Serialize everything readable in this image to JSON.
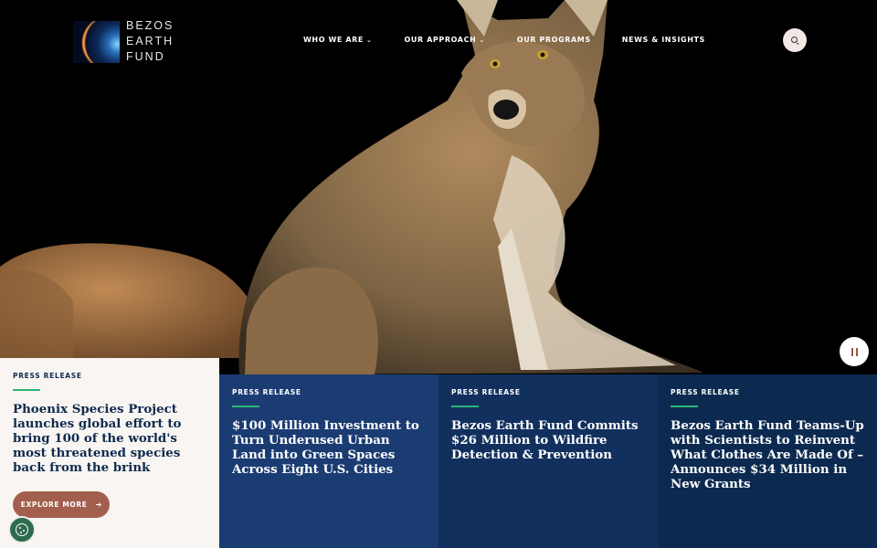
{
  "brand": {
    "name_lines": [
      "BEZOS",
      "EARTH",
      "FUND"
    ]
  },
  "nav": {
    "items": [
      {
        "label": "WHO WE ARE",
        "has_dropdown": true
      },
      {
        "label": "OUR APPROACH",
        "has_dropdown": true
      },
      {
        "label": "OUR PROGRAMS",
        "has_dropdown": false
      },
      {
        "label": "NEWS & INSIGHTS",
        "has_dropdown": false
      }
    ],
    "dropdown_icon": "chevron-down-icon"
  },
  "header": {
    "search_icon": "search-icon"
  },
  "hero": {
    "pause_icon": "pause-icon"
  },
  "featured": {
    "label": "PRESS RELEASE",
    "headline": "Phoenix Species Project launches global effort to bring 100 of the world's most threatened species back from the brink",
    "button_label": "EXPLORE MORE",
    "button_icon": "arrow-right-icon"
  },
  "cards": [
    {
      "label": "PRESS RELEASE",
      "headline": "$100 Million Investment to Turn Underused Urban Land into Green Spaces Across Eight U.S. Cities"
    },
    {
      "label": "PRESS RELEASE",
      "headline": "Bezos Earth Fund Commits $26 Million to Wildfire Detection & Prevention"
    },
    {
      "label": "PRESS RELEASE",
      "headline": "Bezos Earth Fund Teams-Up with Scientists to Reinvent What Clothes Are Made Of – Announces $34 Million in New Grants"
    }
  ],
  "cookie": {
    "icon": "cookie-icon"
  },
  "colors": {
    "accent_green": "#2bb673",
    "button_brown": "#a35f4d",
    "navy_1": "#1b3c72",
    "navy_2": "#12305e",
    "navy_3": "#0c2a50",
    "featured_bg": "#f9f5f2"
  }
}
